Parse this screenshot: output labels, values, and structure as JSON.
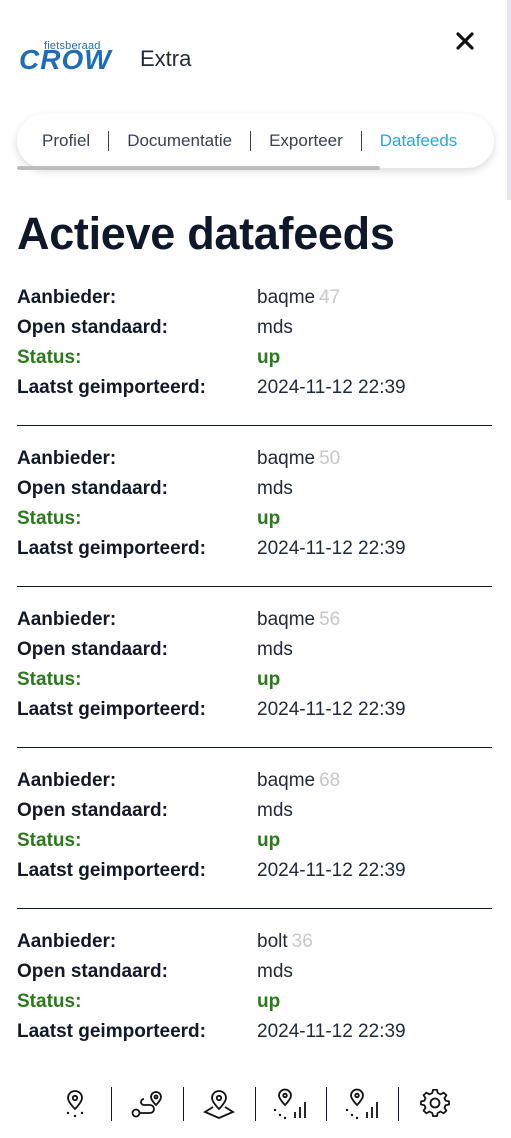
{
  "header": {
    "logo_small": "fietsberaad",
    "logo_big": "CROW",
    "app_title": "Extra"
  },
  "tabs": [
    {
      "label": "Profiel",
      "active": false
    },
    {
      "label": "Documentatie",
      "active": false
    },
    {
      "label": "Exporteer",
      "active": false
    },
    {
      "label": "Datafeeds",
      "active": true
    }
  ],
  "page": {
    "title": "Actieve datafeeds"
  },
  "labels": {
    "provider": "Aanbieder:",
    "standard": "Open standaard:",
    "status": "Status:",
    "last_imported": "Laatst geimporteerd:"
  },
  "feeds": [
    {
      "provider": "baqme",
      "id": "47",
      "standard": "mds",
      "status": "up",
      "last_imported": "2024-11-12 22:39"
    },
    {
      "provider": "baqme",
      "id": "50",
      "standard": "mds",
      "status": "up",
      "last_imported": "2024-11-12 22:39"
    },
    {
      "provider": "baqme",
      "id": "56",
      "standard": "mds",
      "status": "up",
      "last_imported": "2024-11-12 22:39"
    },
    {
      "provider": "baqme",
      "id": "68",
      "standard": "mds",
      "status": "up",
      "last_imported": "2024-11-12 22:39"
    },
    {
      "provider": "bolt",
      "id": "36",
      "standard": "mds",
      "status": "up",
      "last_imported": "2024-11-12 22:39"
    }
  ],
  "bottom_nav": [
    {
      "icon": "map-pin-dot-icon"
    },
    {
      "icon": "route-icon"
    },
    {
      "icon": "map-area-pin-icon"
    },
    {
      "icon": "pin-signal-icon"
    },
    {
      "icon": "pin-signal-alt-icon"
    },
    {
      "icon": "gear-icon"
    }
  ],
  "colors": {
    "brand": "#1d6eb6",
    "active_tab": "#2aa5d6",
    "status_up": "#2a7a1a",
    "id_muted": "#c7c7c7"
  }
}
